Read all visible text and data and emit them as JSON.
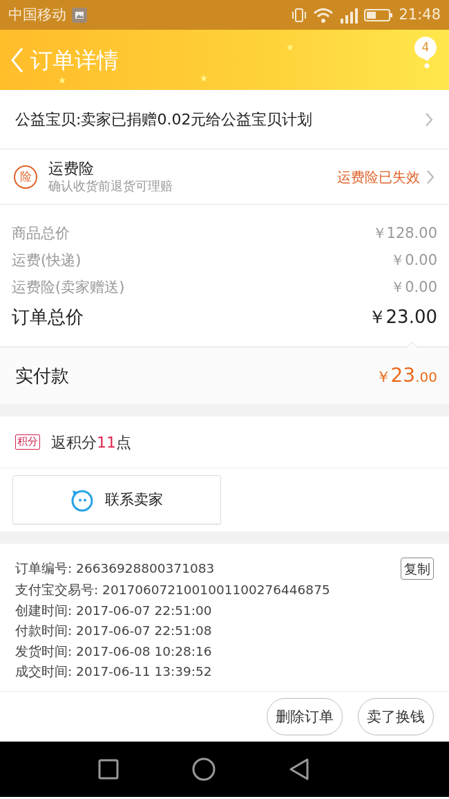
{
  "status_bar": {
    "carrier": "中国移动",
    "time": "21:48"
  },
  "header": {
    "title": "订单详情",
    "badge": "4"
  },
  "donation": {
    "text": "公益宝贝:卖家已捐赠0.02元给公益宝贝计划"
  },
  "insurance": {
    "icon_text": "险",
    "title": "运费险",
    "subtitle": "确认收货前退货可理赔",
    "status": "运费险已失效"
  },
  "prices": [
    {
      "label": "商品总价",
      "value": "￥128.00",
      "kind": "minor"
    },
    {
      "label": "运费(快递)",
      "value": "￥0.00",
      "kind": "minor"
    },
    {
      "label": "运费险(卖家赠送)",
      "value": "￥0.00",
      "kind": "minor"
    },
    {
      "label": "订单总价",
      "value": "￥23.00",
      "kind": "total"
    }
  ],
  "paid": {
    "label": "实付款",
    "currency": "￥",
    "amount": "23",
    "decimals": ".00"
  },
  "points": {
    "tag": "积分",
    "prefix": "返积分",
    "number": "11",
    "suffix": "点"
  },
  "contact_button": {
    "label": "联系卖家"
  },
  "order_info": [
    {
      "label": "订单编号:",
      "value": "26636928800371083",
      "copy": "复制"
    },
    {
      "label": "支付宝交易号:",
      "value": "2017060721001001100276446875"
    },
    {
      "label": "创建时间:",
      "value": "2017-06-07 22:51:00"
    },
    {
      "label": "付款时间:",
      "value": "2017-06-07 22:51:08"
    },
    {
      "label": "发货时间:",
      "value": "2017-06-08 10:28:16"
    },
    {
      "label": "成交时间:",
      "value": "2017-06-11 13:39:52"
    }
  ],
  "actions": [
    "删除订单",
    "卖了换钱"
  ]
}
